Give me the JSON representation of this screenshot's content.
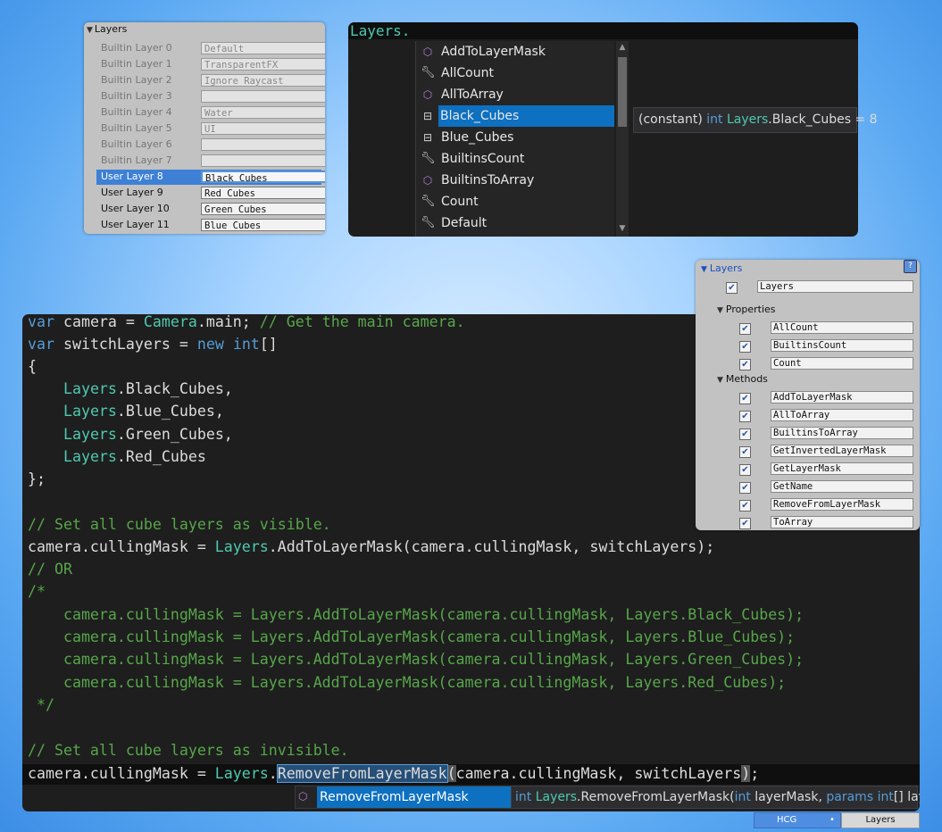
{
  "layers_panel": {
    "title": "Layers",
    "rows": [
      {
        "label": "Builtin Layer 0",
        "value": "Default"
      },
      {
        "label": "Builtin Layer 1",
        "value": "TransparentFX"
      },
      {
        "label": "Builtin Layer 2",
        "value": "Ignore Raycast"
      },
      {
        "label": "Builtin Layer 3",
        "value": ""
      },
      {
        "label": "Builtin Layer 4",
        "value": "Water"
      },
      {
        "label": "Builtin Layer 5",
        "value": "UI"
      },
      {
        "label": "Builtin Layer 6",
        "value": ""
      },
      {
        "label": "Builtin Layer 7",
        "value": ""
      },
      {
        "label": "User Layer 8",
        "value": "Black Cubes"
      },
      {
        "label": "User Layer 9",
        "value": "Red Cubes"
      },
      {
        "label": "User Layer 10",
        "value": "Green Cubes"
      },
      {
        "label": "User Layer 11",
        "value": "Blue Cubes"
      }
    ]
  },
  "top_autocomplete": {
    "typed": "Layers.",
    "items": [
      {
        "icon": "method-cube-icon",
        "label": "AddToLayerMask"
      },
      {
        "icon": "wrench-icon",
        "label": "AllCount"
      },
      {
        "icon": "method-cube-icon",
        "label": "AllToArray"
      },
      {
        "icon": "constant-icon",
        "label": "Black_Cubes"
      },
      {
        "icon": "constant-icon",
        "label": "Blue_Cubes"
      },
      {
        "icon": "wrench-icon",
        "label": "BuiltinsCount"
      },
      {
        "icon": "method-cube-icon",
        "label": "BuiltinsToArray"
      },
      {
        "icon": "wrench-icon",
        "label": "Count"
      },
      {
        "icon": "wrench-icon",
        "label": "Default"
      }
    ],
    "tooltip": {
      "prefix": "(constant) ",
      "type": "int",
      "class": "Layers",
      "rest": ".Black_Cubes = 8"
    }
  },
  "code": {
    "line1": {
      "kw": "var",
      "a": " camera = ",
      "type": "Camera",
      "b": ".main; ",
      "comment": "// Get the main camera."
    },
    "line2": {
      "kw": "var",
      "a": " switchLayers = ",
      "kw2": "new",
      "sp": " ",
      "kw3": "int",
      "b": "[]"
    },
    "line3": "{",
    "arr": [
      {
        "type": "Layers",
        "rest": ".Black_Cubes,"
      },
      {
        "type": "Layers",
        "rest": ".Blue_Cubes,"
      },
      {
        "type": "Layers",
        "rest": ".Green_Cubes,"
      },
      {
        "type": "Layers",
        "rest": ".Red_Cubes"
      }
    ],
    "close": "};",
    "c_visible": "// Set all cube layers as visible.",
    "add_line": {
      "a": "camera.cullingMask = ",
      "type": "Layers",
      "b": ".AddToLayerMask(camera.cullingMask, switchLayers);"
    },
    "or": "// OR",
    "block_open": "/*",
    "block_lines": [
      "    camera.cullingMask = Layers.AddToLayerMask(camera.cullingMask, Layers.Black_Cubes);",
      "    camera.cullingMask = Layers.AddToLayerMask(camera.cullingMask, Layers.Blue_Cubes);",
      "    camera.cullingMask = Layers.AddToLayerMask(camera.cullingMask, Layers.Green_Cubes);",
      "    camera.cullingMask = Layers.AddToLayerMask(camera.cullingMask, Layers.Red_Cubes);"
    ],
    "block_close": " */",
    "c_invisible": "// Set all cube layers as invisible.",
    "remove_line": {
      "a": "camera.cullingMask = ",
      "type": "Layers",
      "dot": ".",
      "method": "RemoveFromLayerMask",
      "paren": "(",
      "b": "camera.cullingMask, switchLayers",
      "rparen": ")",
      "end": ";"
    }
  },
  "bottom_autocomplete": {
    "item": "RemoveFromLayerMask",
    "tooltip": {
      "kw1": "int",
      "class": "Layers",
      "method": ".RemoveFromLayerMask(",
      "kw2": "int",
      "p1": " layerMask, ",
      "kw3": "params",
      "sp": " ",
      "kw4": "int",
      "p2": "[] layers)"
    }
  },
  "inspector": {
    "title": "Layers",
    "name_field": "Layers",
    "properties_label": "Properties",
    "properties": [
      "AllCount",
      "BuiltinsCount",
      "Count"
    ],
    "methods_label": "Methods",
    "methods": [
      "AddToLayerMask",
      "AllToArray",
      "BuiltinsToArray",
      "GetInvertedLayerMask",
      "GetLayerMask",
      "GetName",
      "RemoveFromLayerMask",
      "ToArray"
    ]
  },
  "statusbar": {
    "seg1": "HCG",
    "dot": "•",
    "seg2": "Layers"
  },
  "colors": {
    "keyword": "#569cd6",
    "type": "#4ec9b0",
    "comment": "#57a64a",
    "selection": "#0e70c0",
    "editor_bg": "#1e1e1e"
  }
}
